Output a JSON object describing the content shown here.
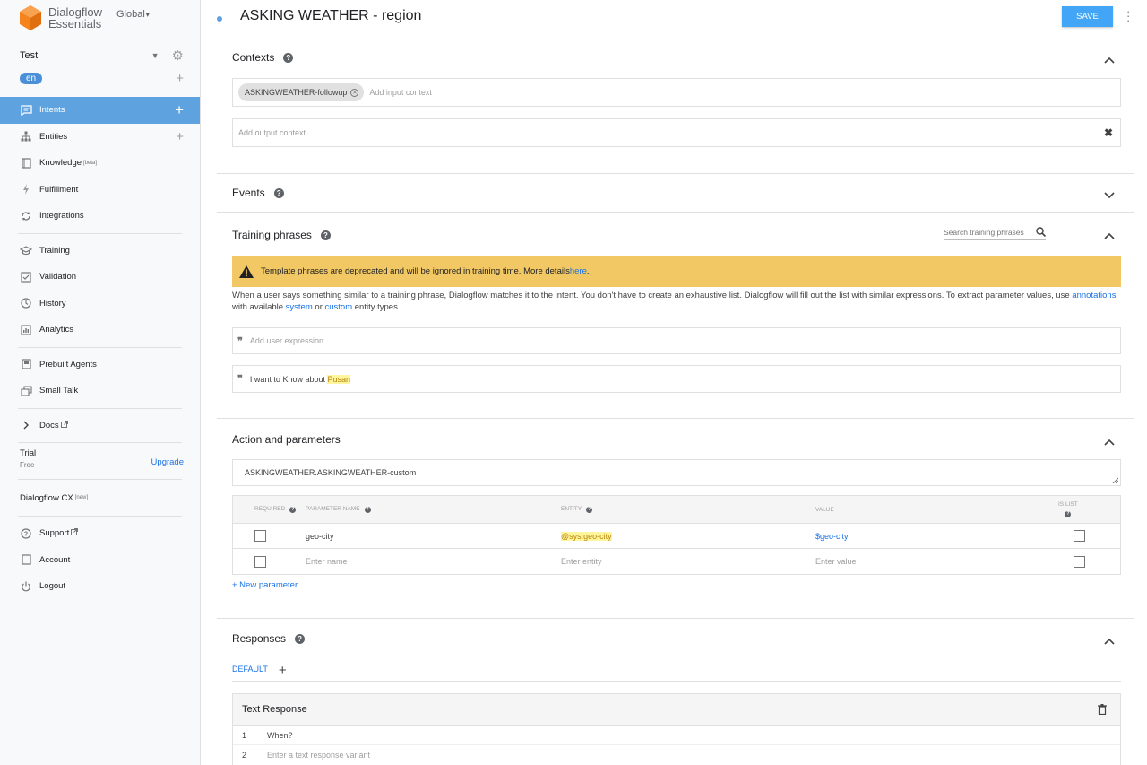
{
  "brand": {
    "line1": "Dialogflow",
    "line2": "Essentials",
    "region": "Global"
  },
  "agent": {
    "name": "Test",
    "language": "en"
  },
  "nav": {
    "intents": "Intents",
    "entities": "Entities",
    "knowledge": "Knowledge",
    "knowledge_badge": "[beta]",
    "fulfillment": "Fulfillment",
    "integrations": "Integrations",
    "training": "Training",
    "validation": "Validation",
    "history": "History",
    "analytics": "Analytics",
    "prebuilt": "Prebuilt Agents",
    "smalltalk": "Small Talk",
    "docs": "Docs",
    "trial": "Trial",
    "trial_plan": "Free",
    "upgrade": "Upgrade",
    "cx": "Dialogflow CX",
    "cx_badge": "[new]",
    "support": "Support",
    "account": "Account",
    "logout": "Logout"
  },
  "header": {
    "title": "ASKING WEATHER - region",
    "save": "SAVE"
  },
  "contexts": {
    "title": "Contexts",
    "input_chip": "ASKINGWEATHER-followup",
    "input_placeholder": "Add input context",
    "output_placeholder": "Add output context"
  },
  "events": {
    "title": "Events"
  },
  "training": {
    "title": "Training phrases",
    "search_placeholder": "Search training phrases",
    "banner_text": "Template phrases are deprecated and will be ignored in training time. More details ",
    "banner_link": "here",
    "banner_end": ".",
    "desc_part1": "When a user says something similar to a training phrase, Dialogflow matches it to the intent. You don't have to create an exhaustive list. Dialogflow will fill out the list with similar expressions. To extract parameter values, use ",
    "desc_annotations": "annotations",
    "desc_part2": " with available ",
    "desc_system": "system",
    "desc_or": " or ",
    "desc_custom": "custom",
    "desc_part3": " entity types.",
    "add_placeholder": "Add user expression",
    "phrase_prefix": "I want to Know about ",
    "phrase_entity": "Pusan"
  },
  "action": {
    "title": "Action and parameters",
    "action_name": "ASKINGWEATHER.ASKINGWEATHER-custom",
    "columns": {
      "required": "REQUIRED",
      "name": "PARAMETER NAME",
      "entity": "ENTITY",
      "value": "VALUE",
      "islist": "IS LIST"
    },
    "rows": [
      {
        "name": "geo-city",
        "entity": "@sys.geo-city",
        "value": "$geo-city"
      }
    ],
    "placeholders": {
      "name": "Enter name",
      "entity": "Enter entity",
      "value": "Enter value"
    },
    "new_param": "+ New parameter"
  },
  "responses": {
    "title": "Responses",
    "tab_default": "DEFAULT",
    "card_title": "Text Response",
    "lines": [
      {
        "num": "1",
        "text": "When?"
      },
      {
        "num": "2",
        "placeholder": "Enter a text response variant"
      }
    ]
  },
  "colors": {
    "accent": "#5ea3e0",
    "save": "#42a5f5",
    "banner": "#f2c864",
    "link": "#1a73e8",
    "brand_orange": "#f5841f"
  }
}
